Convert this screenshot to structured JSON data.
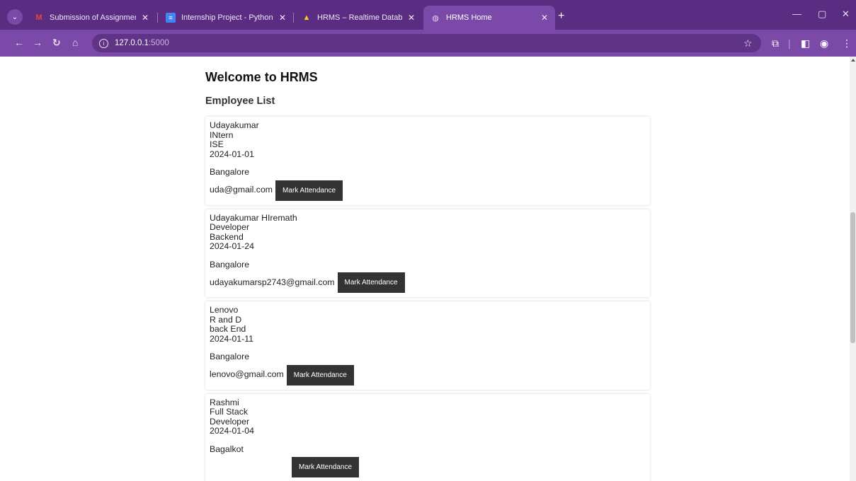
{
  "browser": {
    "tabs": [
      {
        "title": "Submission of Assignment for I",
        "icon": "gmail-icon"
      },
      {
        "title": "Internship Project - Python - Go",
        "icon": "docs-icon"
      },
      {
        "title": "HRMS – Realtime Database – Fi",
        "icon": "firebase-icon"
      },
      {
        "title": "HRMS Home",
        "icon": "globe-icon",
        "active": true
      }
    ],
    "url_host": "127.0.0.1",
    "url_port": ":5000"
  },
  "page": {
    "title": "Welcome to HRMS",
    "subtitle": "Employee List",
    "button_label": "Mark Attendance",
    "employees": [
      {
        "name": "Udayakumar",
        "role": "INtern",
        "dept": "ISE",
        "date": "2024-01-01",
        "location": "Bangalore",
        "email": "uda@gmail.com"
      },
      {
        "name": "Udayakumar HIremath",
        "role": "Developer",
        "dept": "Backend",
        "date": "2024-01-24",
        "location": "Bangalore",
        "email": "udayakumarsp2743@gmail.com"
      },
      {
        "name": "Lenovo",
        "role": "R and D",
        "dept": "back End",
        "date": "2024-01-11",
        "location": "Bangalore",
        "email": "lenovo@gmail.com"
      },
      {
        "name": "Rashmi",
        "role": "Full Stack",
        "dept": "Developer",
        "date": "2024-01-04",
        "location": "Bagalkot",
        "email": ""
      }
    ]
  },
  "colors": {
    "tabbar": "#5a2d82",
    "toolbar": "#7b4aa8",
    "button": "#333333"
  }
}
